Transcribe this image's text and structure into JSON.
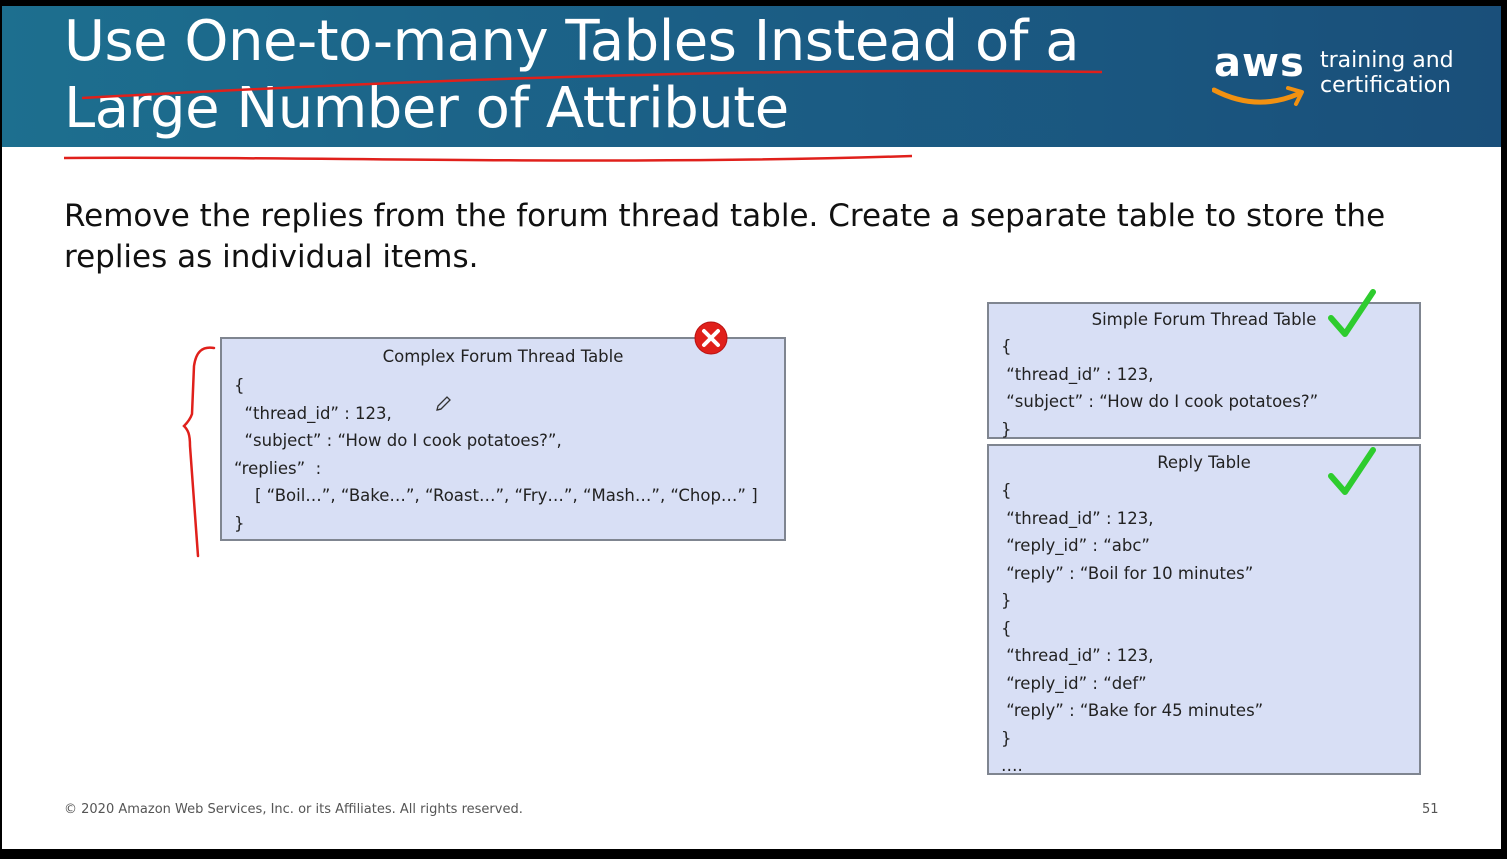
{
  "title": {
    "line1": "Use One-to-many Tables Instead of a",
    "line2": "Large Number of Attribute"
  },
  "logo": {
    "wordmark": "aws",
    "tagline_line1": "training and",
    "tagline_line2": "certification"
  },
  "body": {
    "text": "Remove the replies from the forum thread table. Create a separate table to store the replies as individual items."
  },
  "complex_table": {
    "title": "Complex Forum Thread Table",
    "code": "{\n  “thread_id” : 123,\n  “subject” : “How do I cook potatoes?”,\n“replies”  :\n    [ “Boil…”, “Bake…”, “Roast…”, “Fry…”, “Mash…”, “Chop…” ]\n}",
    "status_icon": "red-x-icon"
  },
  "simple_table": {
    "title": "Simple Forum Thread Table",
    "code": "{\n “thread_id” : 123,\n “subject” : “How do I cook potatoes?”\n}",
    "status_icon": "green-check-icon"
  },
  "reply_table": {
    "title": "Reply Table",
    "code": "{\n “thread_id” : 123,\n “reply_id” : “abc”\n “reply” : “Boil for 10 minutes”\n}\n{\n “thread_id” : 123,\n “reply_id” : “def”\n “reply” : “Bake for 45 minutes”\n}\n….",
    "status_icon": "green-check-icon"
  },
  "footer": {
    "copyright": "© 2020 Amazon Web Services, Inc. or its Affiliates. All rights reserved.",
    "page_number": "51"
  },
  "colors": {
    "header_bg": "#1b5f86",
    "box_bg": "#d8dff5",
    "annotation_red": "#e0201b",
    "check_green": "#2ecc2e"
  }
}
